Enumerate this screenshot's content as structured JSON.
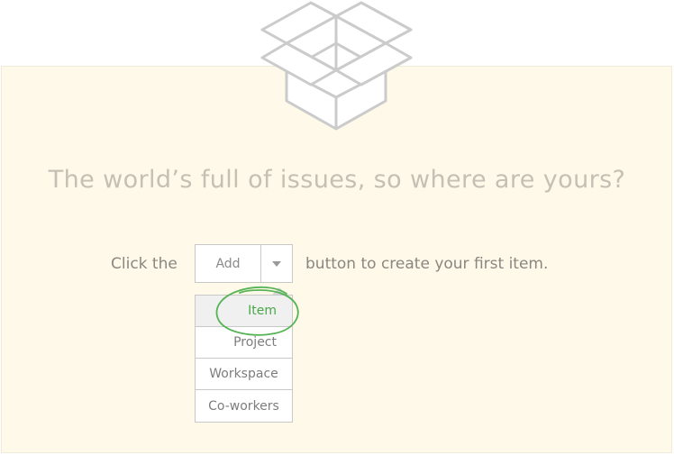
{
  "empty_state": {
    "headline": "The world’s full of issues, so where are yours?",
    "prompt_before": "Click the",
    "prompt_after": "button to create your first item.",
    "illustration_icon": "open-box-icon"
  },
  "add_button": {
    "label": "Add",
    "caret_icon": "caret-down-icon"
  },
  "add_menu": {
    "items": [
      {
        "label": "Item",
        "highlighted": true
      },
      {
        "label": "Project"
      },
      {
        "label": "Workspace"
      },
      {
        "label": "Co-workers"
      }
    ]
  },
  "colors": {
    "panel_background": "#fef9e8",
    "highlight_green": "#4aa84a",
    "muted_text": "#8a8780"
  }
}
